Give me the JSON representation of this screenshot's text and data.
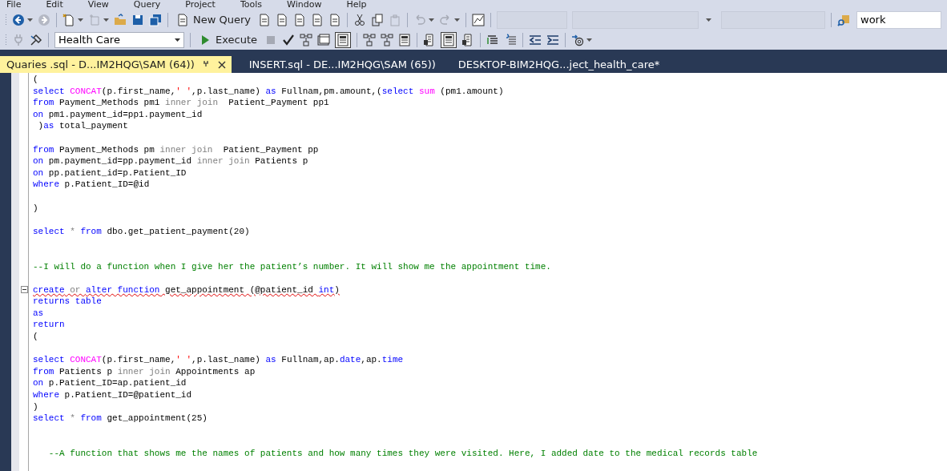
{
  "menu": [
    {
      "label": "File"
    },
    {
      "label": "Edit"
    },
    {
      "label": "View"
    },
    {
      "label": "Query"
    },
    {
      "label": "Project"
    },
    {
      "label": "Tools"
    },
    {
      "label": "Window"
    },
    {
      "label": "Help"
    }
  ],
  "toolbar": {
    "new_query": "New Query",
    "search_value": "work",
    "database": "Health Care",
    "execute": "Execute"
  },
  "tabs": [
    {
      "label": "Quaries .sql - D...IM2HQG\\SAM (64))",
      "selected": true
    },
    {
      "label": "INSERT.sql - DE...IM2HQG\\SAM (65))",
      "selected": false
    },
    {
      "label": "DESKTOP-BIM2HQG...ject_health_care*",
      "selected": false
    }
  ],
  "editor": {
    "lines": [
      {
        "kind": "code",
        "tokens": [
          {
            "kind": "plain",
            "text": "("
          }
        ]
      },
      {
        "kind": "code",
        "tokens": [
          {
            "kind": "keyword",
            "text": "select "
          },
          {
            "kind": "function",
            "text": "CONCAT"
          },
          {
            "kind": "plain",
            "text": "(p.first_name,"
          },
          {
            "kind": "string",
            "text": "' '"
          },
          {
            "kind": "plain",
            "text": ",p.last_name) "
          },
          {
            "kind": "keyword",
            "text": "as"
          },
          {
            "kind": "plain",
            "text": " Fullnam,pm.amount,("
          },
          {
            "kind": "keyword",
            "text": "select "
          },
          {
            "kind": "function",
            "text": "sum"
          },
          {
            "kind": "plain",
            "text": " (pm1.amount)"
          }
        ]
      },
      {
        "kind": "code",
        "tokens": [
          {
            "kind": "keyword",
            "text": "from"
          },
          {
            "kind": "plain",
            "text": " Payment_Methods pm1 "
          },
          {
            "kind": "operator",
            "text": "inner join"
          },
          {
            "kind": "plain",
            "text": "  Patient_Payment pp1"
          }
        ]
      },
      {
        "kind": "code",
        "tokens": [
          {
            "kind": "keyword",
            "text": "on"
          },
          {
            "kind": "plain",
            "text": " pm1.payment_id=pp1.payment_id"
          }
        ]
      },
      {
        "kind": "code",
        "tokens": [
          {
            "kind": "plain",
            "text": " )"
          },
          {
            "kind": "keyword",
            "text": "as"
          },
          {
            "kind": "plain",
            "text": " total_payment"
          }
        ]
      },
      {
        "kind": "blank"
      },
      {
        "kind": "code",
        "tokens": [
          {
            "kind": "keyword",
            "text": "from"
          },
          {
            "kind": "plain",
            "text": " Payment_Methods pm "
          },
          {
            "kind": "operator",
            "text": "inner join"
          },
          {
            "kind": "plain",
            "text": "  Patient_Payment pp"
          }
        ]
      },
      {
        "kind": "code",
        "tokens": [
          {
            "kind": "keyword",
            "text": "on"
          },
          {
            "kind": "plain",
            "text": " pm.payment_id=pp.payment_id "
          },
          {
            "kind": "operator",
            "text": "inner join"
          },
          {
            "kind": "plain",
            "text": " Patients p"
          }
        ]
      },
      {
        "kind": "code",
        "tokens": [
          {
            "kind": "keyword",
            "text": "on"
          },
          {
            "kind": "plain",
            "text": " pp.patient_id=p.Patient_ID"
          }
        ]
      },
      {
        "kind": "code",
        "tokens": [
          {
            "kind": "keyword",
            "text": "where"
          },
          {
            "kind": "plain",
            "text": " p.Patient_ID=@id"
          }
        ]
      },
      {
        "kind": "blank"
      },
      {
        "kind": "code",
        "tokens": [
          {
            "kind": "plain",
            "text": ")"
          }
        ]
      },
      {
        "kind": "blank"
      },
      {
        "kind": "code",
        "tokens": [
          {
            "kind": "keyword",
            "text": "select"
          },
          {
            "kind": "operator",
            "text": " * "
          },
          {
            "kind": "keyword",
            "text": "from"
          },
          {
            "kind": "plain",
            "text": " dbo.get_patient_payment(20)"
          }
        ]
      },
      {
        "kind": "blank"
      },
      {
        "kind": "blank"
      },
      {
        "kind": "code",
        "tokens": [
          {
            "kind": "comment",
            "text": "--I will do a function when I give her the patient’s number. It will show me the appointment time."
          }
        ]
      },
      {
        "kind": "blank"
      },
      {
        "kind": "code",
        "error": true,
        "fold": true,
        "tokens": [
          {
            "kind": "keyword",
            "text": "create"
          },
          {
            "kind": "operator",
            "text": " or "
          },
          {
            "kind": "keyword",
            "text": "alter function"
          },
          {
            "kind": "plain",
            "text": " get_appointment (@patient_id "
          },
          {
            "kind": "keyword",
            "text": "int"
          },
          {
            "kind": "plain",
            "text": ")"
          }
        ]
      },
      {
        "kind": "code",
        "tokens": [
          {
            "kind": "keyword",
            "text": "returns table"
          }
        ]
      },
      {
        "kind": "code",
        "tokens": [
          {
            "kind": "keyword",
            "text": "as"
          }
        ]
      },
      {
        "kind": "code",
        "tokens": [
          {
            "kind": "keyword",
            "text": "return"
          }
        ]
      },
      {
        "kind": "code",
        "tokens": [
          {
            "kind": "plain",
            "text": "("
          }
        ]
      },
      {
        "kind": "blank"
      },
      {
        "kind": "code",
        "tokens": [
          {
            "kind": "keyword",
            "text": "select "
          },
          {
            "kind": "function",
            "text": "CONCAT"
          },
          {
            "kind": "plain",
            "text": "(p.first_name,"
          },
          {
            "kind": "string",
            "text": "' '"
          },
          {
            "kind": "plain",
            "text": ",p.last_name) "
          },
          {
            "kind": "keyword",
            "text": "as"
          },
          {
            "kind": "plain",
            "text": " Fullnam,ap."
          },
          {
            "kind": "keyword",
            "text": "date"
          },
          {
            "kind": "plain",
            "text": ",ap."
          },
          {
            "kind": "keyword",
            "text": "time"
          }
        ]
      },
      {
        "kind": "code",
        "tokens": [
          {
            "kind": "keyword",
            "text": "from"
          },
          {
            "kind": "plain",
            "text": " Patients p "
          },
          {
            "kind": "operator",
            "text": "inner join"
          },
          {
            "kind": "plain",
            "text": " Appointments ap"
          }
        ]
      },
      {
        "kind": "code",
        "tokens": [
          {
            "kind": "keyword",
            "text": "on"
          },
          {
            "kind": "plain",
            "text": " p.Patient_ID=ap.patient_id"
          }
        ]
      },
      {
        "kind": "code",
        "tokens": [
          {
            "kind": "keyword",
            "text": "where"
          },
          {
            "kind": "plain",
            "text": " p.Patient_ID=@patient_id"
          }
        ]
      },
      {
        "kind": "code",
        "tokens": [
          {
            "kind": "plain",
            "text": ")"
          }
        ]
      },
      {
        "kind": "code",
        "tokens": [
          {
            "kind": "keyword",
            "text": "select"
          },
          {
            "kind": "operator",
            "text": " * "
          },
          {
            "kind": "keyword",
            "text": "from"
          },
          {
            "kind": "plain",
            "text": " get_appointment(25)"
          }
        ]
      },
      {
        "kind": "blank"
      },
      {
        "kind": "blank"
      },
      {
        "kind": "code",
        "tokens": [
          {
            "kind": "comment",
            "text": "   --A function that shows me the names of patients and how many times they were visited. Here, I added date to the medical records table"
          }
        ]
      }
    ]
  }
}
